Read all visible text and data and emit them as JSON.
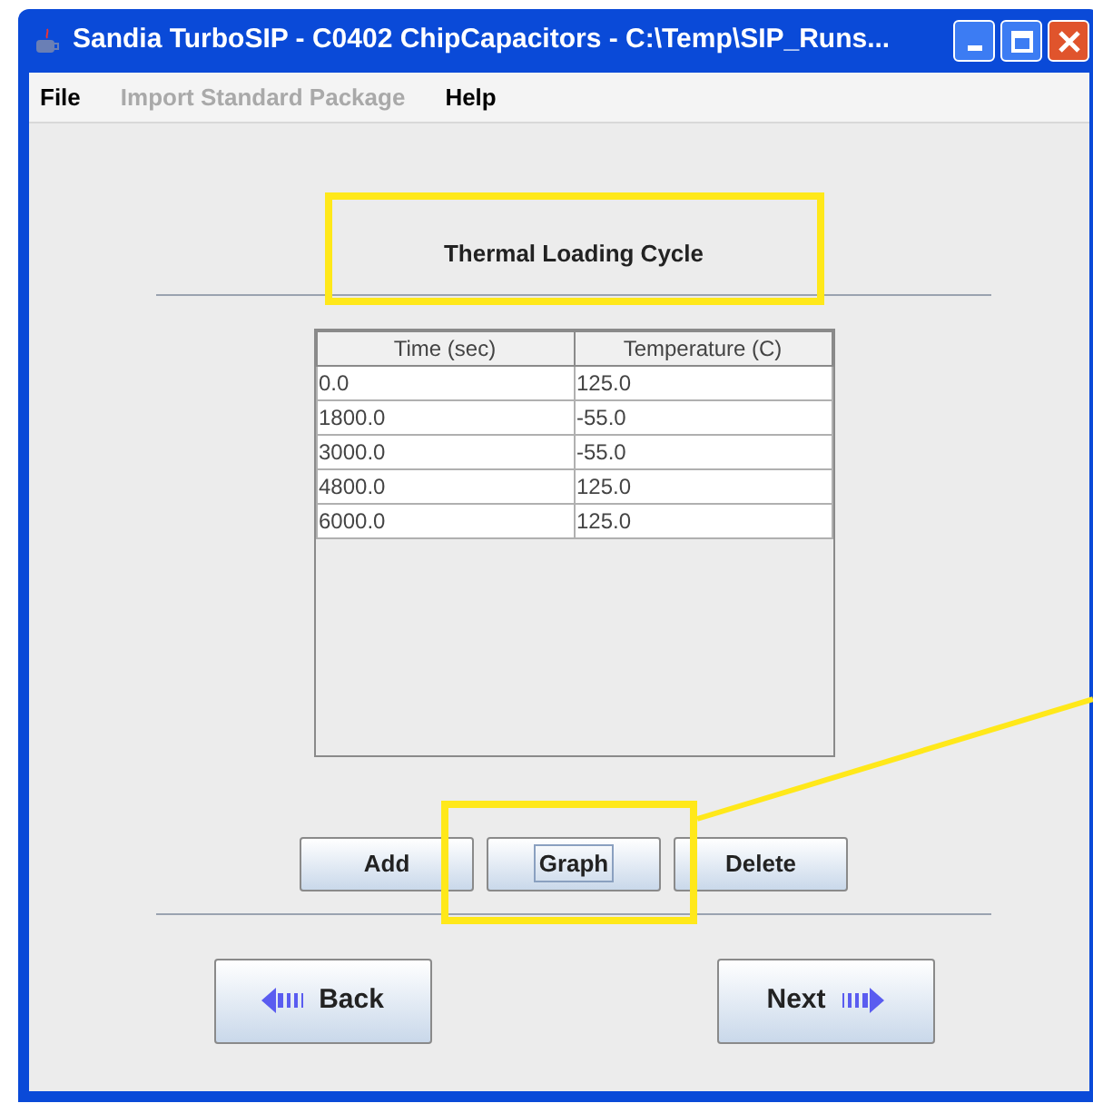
{
  "window": {
    "title": "Sandia TurboSIP - C0402 ChipCapacitors - C:\\Temp\\SIP_Runs..."
  },
  "menu": [
    {
      "label": "File",
      "disabled": false
    },
    {
      "label": "Import Standard Package",
      "disabled": true
    },
    {
      "label": "Help",
      "disabled": false
    }
  ],
  "heading": "Thermal Loading Cycle",
  "table": {
    "columns": [
      "Time (sec)",
      "Temperature (C)"
    ],
    "rows": [
      [
        "0.0",
        "125.0"
      ],
      [
        "1800.0",
        "-55.0"
      ],
      [
        "3000.0",
        "-55.0"
      ],
      [
        "4800.0",
        "125.0"
      ],
      [
        "6000.0",
        "125.0"
      ]
    ]
  },
  "buttons": [
    {
      "label": "Add",
      "focused": false
    },
    {
      "label": "Graph",
      "focused": true
    },
    {
      "label": "Delete",
      "focused": false
    }
  ],
  "navigation": [
    {
      "label": "Back",
      "kind": "back"
    },
    {
      "label": "Next",
      "kind": "next"
    }
  ]
}
